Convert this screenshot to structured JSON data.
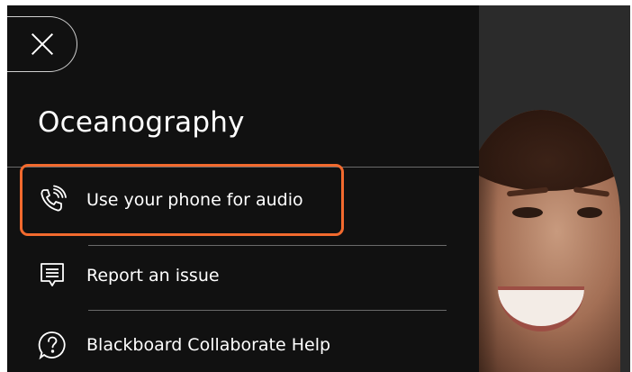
{
  "panel": {
    "title": "Oceanography",
    "close_icon": "close-icon"
  },
  "menu": {
    "items": [
      {
        "label": "Use your phone for audio",
        "icon": "phone-audio-icon",
        "highlighted": true,
        "highlight_color": "#f26a2e"
      },
      {
        "label": "Report an issue",
        "icon": "report-issue-icon",
        "highlighted": false
      },
      {
        "label": "Blackboard Collaborate Help",
        "icon": "help-icon",
        "highlighted": false
      }
    ]
  },
  "colors": {
    "panel_bg": "#111111",
    "text": "#ffffff",
    "divider": "#6a6a6a",
    "accent_highlight": "#f26a2e"
  }
}
